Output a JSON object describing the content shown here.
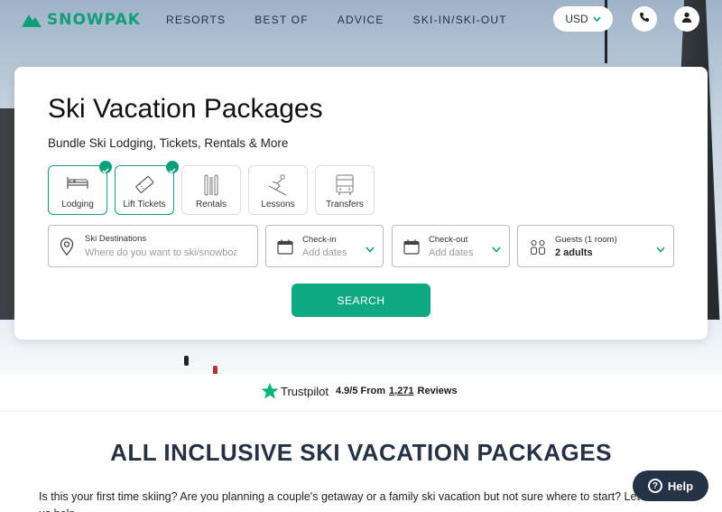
{
  "brand": {
    "name": "SNOWPAK",
    "color": "#0e9f7a"
  },
  "nav": {
    "links": [
      "RESORTS",
      "BEST OF",
      "ADVICE",
      "SKI-IN/SKI-OUT"
    ],
    "currency": "USD",
    "phone_icon": "phone-icon",
    "user_icon": "user-icon"
  },
  "search_card": {
    "title": "Ski Vacation Packages",
    "subtitle": "Bundle Ski Lodging, Tickets, Rentals & More",
    "options": [
      {
        "label": "Lodging",
        "icon": "bed-icon",
        "selected": true
      },
      {
        "label": "Lift Tickets",
        "icon": "ticket-icon",
        "selected": true
      },
      {
        "label": "Rentals",
        "icon": "skis-icon",
        "selected": false
      },
      {
        "label": "Lessons",
        "icon": "skier-icon",
        "selected": false
      },
      {
        "label": "Transfers",
        "icon": "bus-icon",
        "selected": false
      }
    ],
    "destination": {
      "label": "Ski Destinations",
      "placeholder": "Where do you want to ski/snowboard?"
    },
    "checkin": {
      "label": "Check-in",
      "placeholder": "Add dates"
    },
    "checkout": {
      "label": "Check-out",
      "placeholder": "Add dates"
    },
    "guests": {
      "label": "Guests (1 room)",
      "value": "2 adults"
    },
    "search_button": "SEARCH"
  },
  "trustpilot": {
    "name": "Trustpilot",
    "rating": "4.9/5 From",
    "count": "1,271",
    "suffix": "Reviews"
  },
  "section": {
    "title": "ALL INCLUSIVE SKI VACATION PACKAGES",
    "intro": "Is this your first time skiing? Are you planning a couple's getaway or a family ski vacation but not sure where to start? Let us help."
  },
  "help_button": "Help",
  "colors": {
    "accent": "#0ea882",
    "navy": "#253246"
  }
}
